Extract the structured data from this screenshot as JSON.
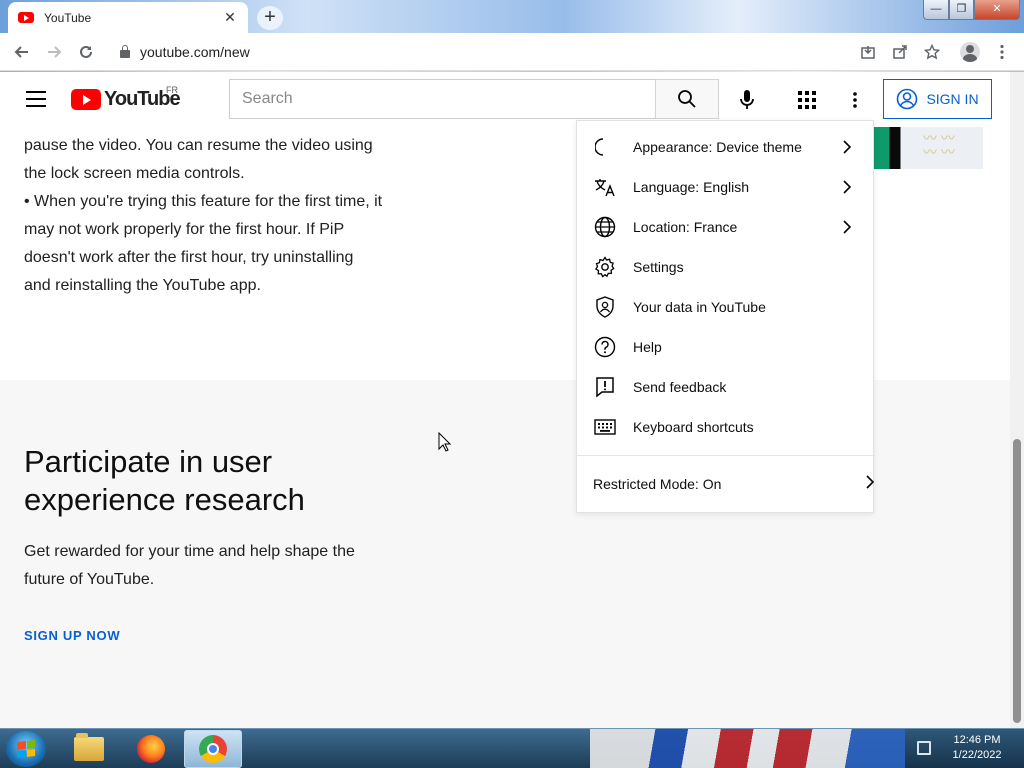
{
  "browser": {
    "tab_title": "YouTube",
    "tab_close": "✕",
    "new_tab": "+",
    "url": "youtube.com/new",
    "window_min": "—",
    "window_max": "❐",
    "window_close": "✕"
  },
  "youtube": {
    "logo_word": "YouTube",
    "country_code": "FR",
    "search_placeholder": "Search",
    "signin_label": "SIGN IN"
  },
  "content": {
    "paragraph": "pause the video. You can resume the video using the lock screen media controls.",
    "bullet_1": "• When you're trying this feature for the first time, it may not work properly for the first hour. If PiP doesn't work after the first hour, try uninstalling and reinstalling the YouTube app.",
    "research_title": "Participate in user experience research",
    "research_desc": "Get rewarded for your time and help shape the future of YouTube.",
    "signup_label": "SIGN UP NOW"
  },
  "menu": {
    "items": [
      {
        "label": "Appearance: Device theme",
        "icon": "moon-icon",
        "chevron": true
      },
      {
        "label": "Language: English",
        "icon": "translate-icon",
        "chevron": true
      },
      {
        "label": "Location: France",
        "icon": "globe-icon",
        "chevron": true
      },
      {
        "label": "Settings",
        "icon": "gear-icon",
        "chevron": false
      },
      {
        "label": "Your data in YouTube",
        "icon": "shield-user-icon",
        "chevron": false
      },
      {
        "label": "Help",
        "icon": "help-icon",
        "chevron": false
      },
      {
        "label": "Send feedback",
        "icon": "feedback-icon",
        "chevron": false
      },
      {
        "label": "Keyboard shortcuts",
        "icon": "keyboard-icon",
        "chevron": false
      }
    ],
    "restricted_mode": "Restricted Mode: On"
  },
  "taskbar": {
    "time": "12:46 PM",
    "date": "1/22/2022"
  },
  "colors": {
    "brand_red": "#ff0000",
    "link_blue": "#065fd4"
  }
}
